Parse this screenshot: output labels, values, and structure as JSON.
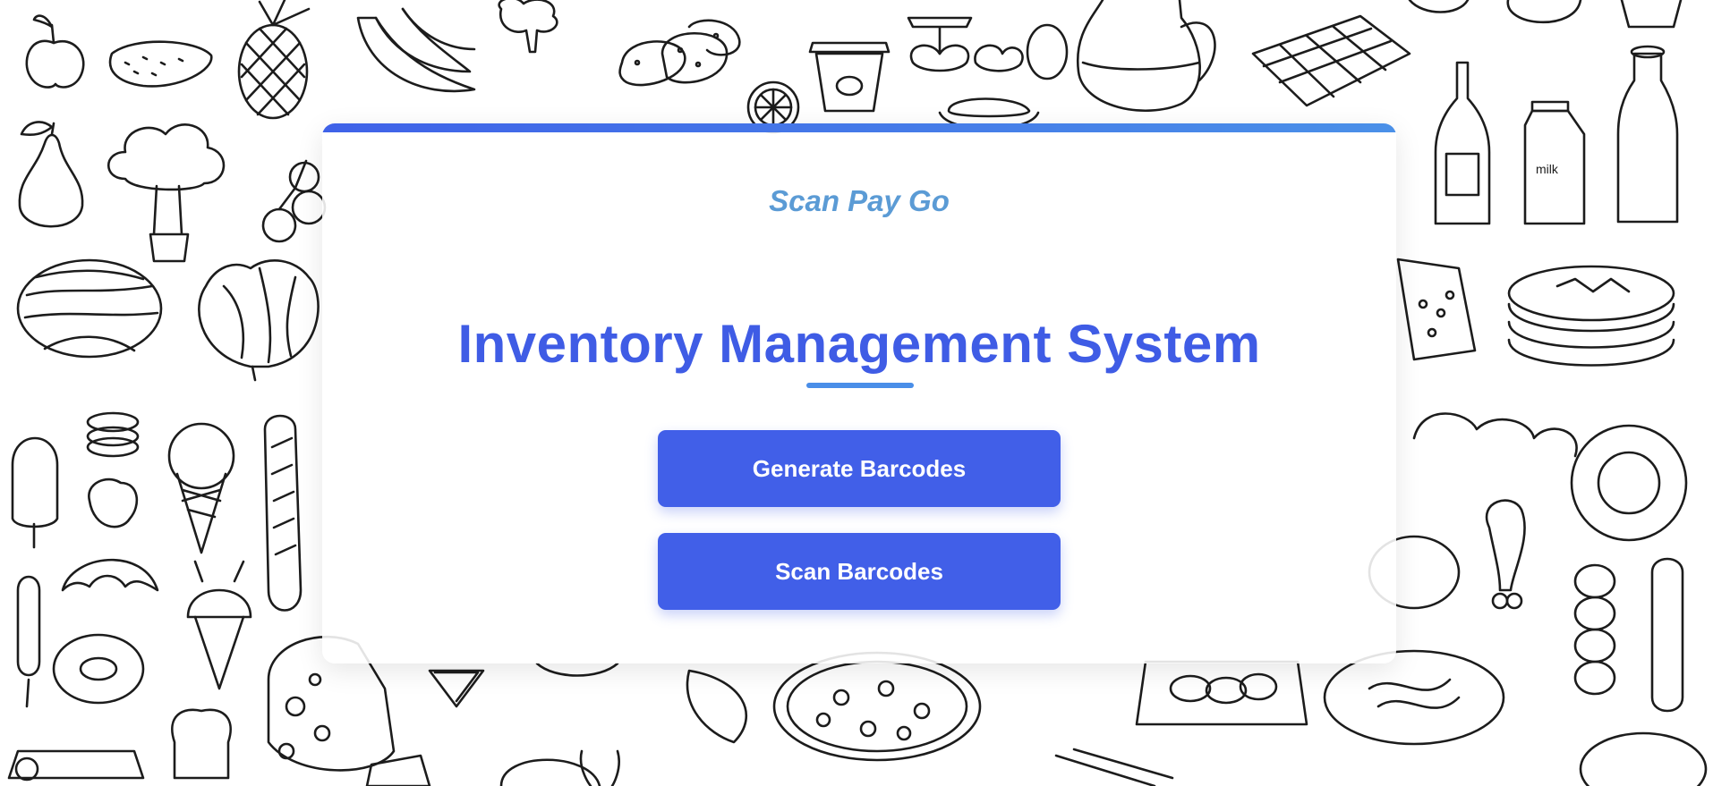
{
  "app": {
    "brand": "Scan Pay Go",
    "title": "Inventory Management System"
  },
  "actions": {
    "generate_label": "Generate Barcodes",
    "scan_label": "Scan Barcodes"
  },
  "background": {
    "style": "hand-drawn grocery doodle pattern",
    "carton_text": "milk"
  },
  "colors": {
    "accent": "#415fe8",
    "title": "#3f5ce5",
    "brand": "#5b9bd5",
    "bar_start": "#3f62e8",
    "bar_end": "#4a90e8"
  }
}
